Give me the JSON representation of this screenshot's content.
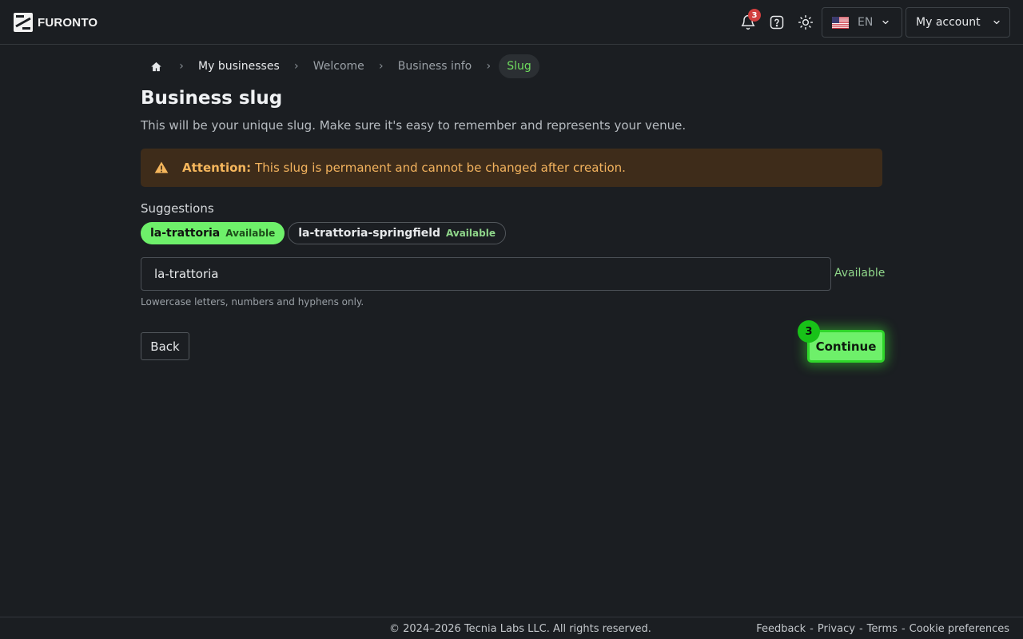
{
  "header": {
    "logo_text": "FURONTO",
    "notifications_count": "3",
    "language": "EN",
    "account_label": "My account"
  },
  "breadcrumb": {
    "items": [
      "My businesses",
      "Welcome",
      "Business info",
      "Slug"
    ]
  },
  "page": {
    "title": "Business slug",
    "subtitle": "This will be your unique slug. Make sure it's easy to remember and represents your venue."
  },
  "alert": {
    "strong": "Attention:",
    "text": "This slug is permanent and cannot be changed after creation."
  },
  "suggestions": {
    "label": "Suggestions",
    "items": [
      {
        "name": "la-trattoria",
        "status": "Available",
        "selected": true
      },
      {
        "name": "la-trattoria-springfield",
        "status": "Available",
        "selected": false
      }
    ]
  },
  "slug_field": {
    "value": "la-trattoria",
    "status": "Available",
    "hint": "Lowercase letters, numbers and hyphens only."
  },
  "actions": {
    "back_label": "Back",
    "continue_label": "Continue",
    "step_badge": "3"
  },
  "footer": {
    "copyright": "© 2024–2026 Tecnia Labs LLC. All rights reserved.",
    "links": [
      "Feedback",
      "Privacy",
      "Terms",
      "Cookie preferences"
    ],
    "separator": "-"
  },
  "colors": {
    "background": "#1b1e22",
    "accent_green": "#6ef06a",
    "alert_bg": "#3e2c1a",
    "alert_text": "#f3b35e",
    "badge_red": "#d13f3f"
  }
}
